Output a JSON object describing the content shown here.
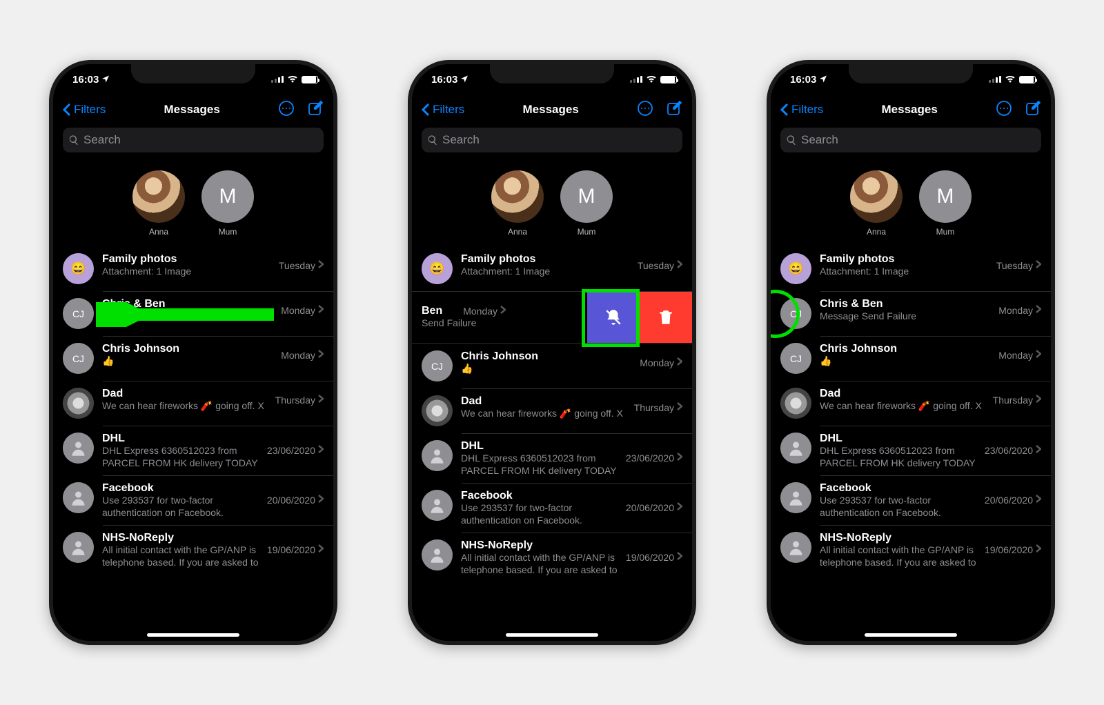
{
  "status": {
    "time": "16:03"
  },
  "nav": {
    "back": "Filters",
    "title": "Messages"
  },
  "search": {
    "placeholder": "Search"
  },
  "pinned": [
    {
      "name": "Anna",
      "avatar": "photo1"
    },
    {
      "name": "Mum",
      "avatar": "initial",
      "initial": "M"
    }
  ],
  "conversations": [
    {
      "id": "family",
      "title": "Family photos",
      "preview": "Attachment: 1 Image",
      "date": "Tuesday",
      "avatar": "emoji",
      "emoji": "😄"
    },
    {
      "id": "chrisben",
      "title": "Chris & Ben",
      "preview": "Message Send Failure",
      "date": "Monday",
      "avatar": "initial",
      "initial": "CJ"
    },
    {
      "id": "chrisj",
      "title": "Chris Johnson",
      "preview": "👍",
      "date": "Monday",
      "avatar": "initial",
      "initial": "CJ"
    },
    {
      "id": "dad",
      "title": "Dad",
      "preview": "We can hear fireworks 🧨 going off. X",
      "date": "Thursday",
      "avatar": "photo-dad"
    },
    {
      "id": "dhl",
      "title": "DHL",
      "preview": "DHL Express 6360512023 from PARCEL FROM HK delivery TODAY bef…",
      "date": "23/06/2020",
      "avatar": "person"
    },
    {
      "id": "fb",
      "title": "Facebook",
      "preview": "Use 293537 for two-factor authentication on Facebook.",
      "date": "20/06/2020",
      "avatar": "person"
    },
    {
      "id": "nhs",
      "title": "NHS-NoReply",
      "preview": "All initial contact with the GP/ANP is telephone based. If you are asked to a…",
      "date": "19/06/2020",
      "avatar": "person"
    }
  ],
  "swipe": {
    "visible_title_suffix": "Ben",
    "visible_preview_suffix": "Send Failure",
    "date": "Monday"
  },
  "swipe_actions": {
    "mute": "Hide Alerts",
    "delete": "Delete"
  }
}
